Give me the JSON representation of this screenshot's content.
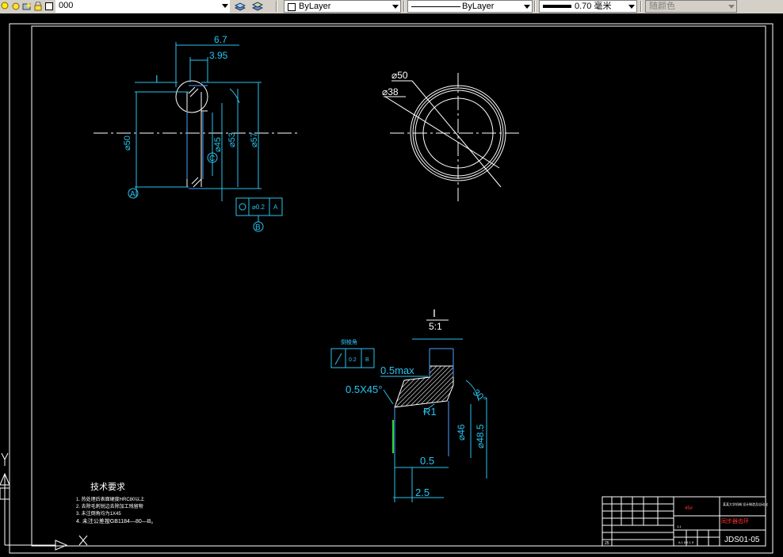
{
  "toolbar": {
    "layer_name": "000",
    "color_value": "ByLayer",
    "linetype_value": "ByLayer",
    "lineweight_value": "0.70 毫米",
    "plotstyle_value": "随颜色"
  },
  "drawing": {
    "front_view": {
      "dims": {
        "d_6_7": "6.7",
        "d_3_95": "3.95",
        "d_phi50": "⌀50",
        "d_phi45": "⌀45",
        "d_phi53": "⌀53",
        "d_phi57": "⌀57"
      },
      "detail_ref": "I",
      "datum_a": "A",
      "datum_b": "B",
      "datum_c": "C",
      "tol_value": "⌀0.2",
      "tol_ref": "A"
    },
    "side_view": {
      "d_phi50": "⌀50",
      "d_phi38": "⌀38"
    },
    "detail": {
      "label": "I",
      "scale": "5:1",
      "d_05max": "0.5max",
      "d_chamfer": "0.5X45°",
      "d_r1": "R1",
      "d_angle30": "30°",
      "d_phi46": "⌀46",
      "d_phi48_5": "⌀48.5",
      "d_0_5": "0.5",
      "d_2_5": "2.5",
      "tol_label": "倒棱角",
      "tol_value": "0.2",
      "tol_ref": "B"
    },
    "tech_req": {
      "title": "技术要求",
      "items": [
        "1. 热处理后表面硬度HRC80以上",
        "2. 去除毛刺锐边去除加工残留物",
        "3. 未注倒角均为1X45",
        "4. 未注公差按GB1184—80—B。"
      ]
    },
    "title_block": {
      "material": "45#",
      "company": "某某大学机械 设计制造及自动化",
      "part_name": "同步器齿环",
      "drawing_no": "JDS01-05",
      "scale": "1:1",
      "sheet": "A 1 8 5 1 5",
      "count": "25"
    }
  }
}
